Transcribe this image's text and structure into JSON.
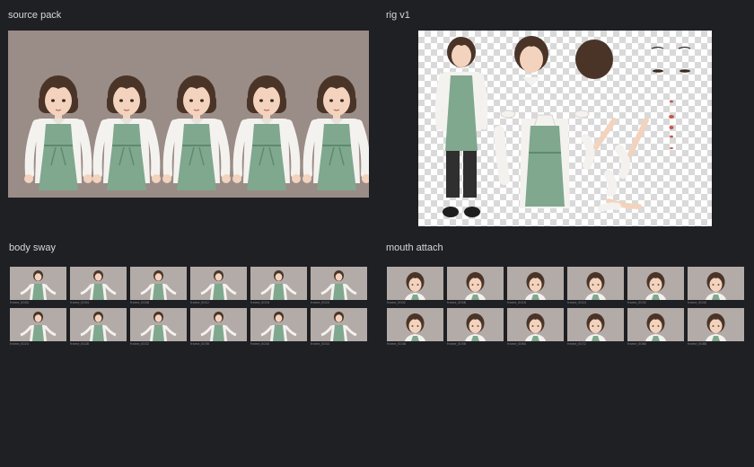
{
  "panels": {
    "source_pack": {
      "title": "source pack"
    },
    "rig": {
      "title": "rig v1"
    },
    "body_sway": {
      "title": "body sway",
      "frames": [
        "frame_0000",
        "frame_0004",
        "frame_0008",
        "frame_0012",
        "frame_0016",
        "frame_0020",
        "frame_0024",
        "frame_0028",
        "frame_0032",
        "frame_0036",
        "frame_0040",
        "frame_0044"
      ]
    },
    "mouth_attach": {
      "title": "mouth attach",
      "frames": [
        "frame_0002",
        "frame_0008",
        "frame_0016",
        "frame_0024",
        "frame_0032",
        "frame_0040",
        "frame_0048",
        "frame_0056",
        "frame_0064",
        "frame_0072",
        "frame_0080",
        "frame_0088"
      ]
    }
  },
  "colors": {
    "background": "#1f2024",
    "apron": "#7fa88e",
    "hair": "#4a3428",
    "skin": "#f3d3bd",
    "shirt": "#f4f2ef"
  }
}
